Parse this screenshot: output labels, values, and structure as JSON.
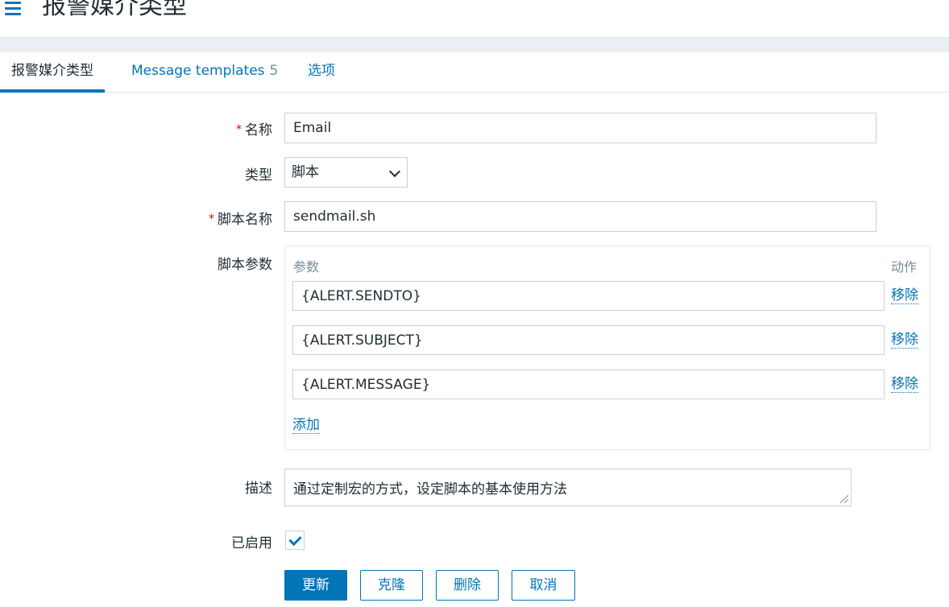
{
  "header": {
    "title": "报警媒介类型"
  },
  "tabs": [
    {
      "label": "报警媒介类型"
    },
    {
      "label": "Message templates",
      "count": "5"
    },
    {
      "label": "选项"
    }
  ],
  "form": {
    "name": {
      "label": "名称",
      "required_mark": "*",
      "value": "Email"
    },
    "type": {
      "label": "类型",
      "value": "脚本"
    },
    "script_name": {
      "label": "脚本名称",
      "required_mark": "*",
      "value": "sendmail.sh"
    },
    "script_params": {
      "label": "脚本参数",
      "col_param": "参数",
      "col_action": "动作",
      "params": [
        {
          "value": "{ALERT.SENDTO}",
          "remove": "移除"
        },
        {
          "value": "{ALERT.SUBJECT}",
          "remove": "移除"
        },
        {
          "value": "{ALERT.MESSAGE}",
          "remove": "移除"
        }
      ],
      "add_label": "添加"
    },
    "description": {
      "label": "描述",
      "value": "通过定制宏的方式，设定脚本的基本使用方法"
    },
    "enabled": {
      "label": "已启用",
      "checked": true
    }
  },
  "buttons": {
    "update": "更新",
    "clone": "克隆",
    "delete": "删除",
    "cancel": "取消"
  },
  "colors": {
    "accent": "#0275b8",
    "required": "#d40000",
    "text": "#1f2c33",
    "muted": "#768d99"
  }
}
